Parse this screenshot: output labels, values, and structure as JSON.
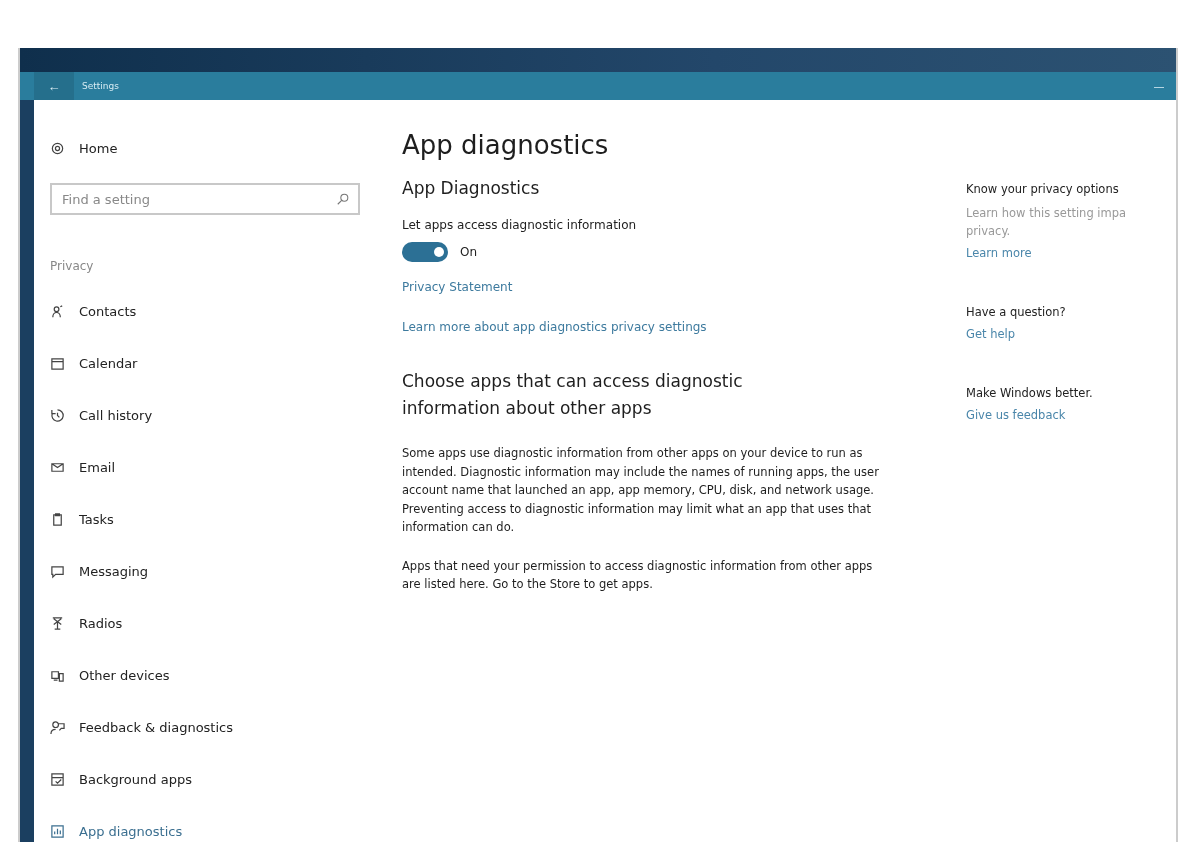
{
  "window": {
    "title": "Settings",
    "back_glyph": "←",
    "minimize_glyph": "—"
  },
  "sidebar": {
    "home": "Home",
    "search": {
      "placeholder": "Find a setting"
    },
    "section": "Privacy",
    "items": [
      {
        "label": "Contacts",
        "selected": false
      },
      {
        "label": "Calendar",
        "selected": false
      },
      {
        "label": "Call history",
        "selected": false
      },
      {
        "label": "Email",
        "selected": false
      },
      {
        "label": "Tasks",
        "selected": false
      },
      {
        "label": "Messaging",
        "selected": false
      },
      {
        "label": "Radios",
        "selected": false
      },
      {
        "label": "Other devices",
        "selected": false
      },
      {
        "label": "Feedback & diagnostics",
        "selected": false
      },
      {
        "label": "Background apps",
        "selected": false
      },
      {
        "label": "App diagnostics",
        "selected": true
      }
    ]
  },
  "content": {
    "title": "App diagnostics",
    "section_title": "App Diagnostics",
    "toggle": {
      "label": "Let apps access diagnostic information",
      "on": true,
      "state_text": "On"
    },
    "links": [
      "Privacy Statement",
      "Learn more about app diagnostics privacy settings"
    ],
    "subheading": "Choose apps that can access diagnostic information about other apps",
    "paragraphs": [
      "Some apps use diagnostic information from other apps on your device to run as intended. Diagnostic information may include the names of running apps, the user account name that launched an app, app memory, CPU, disk, and network usage. Preventing access to diagnostic information may limit what an app that uses that information can do.",
      "Apps that need your permission to access diagnostic information from other apps are listed here. Go to the Store to get apps."
    ]
  },
  "aside": [
    {
      "heading": "Know your privacy options",
      "lines": [
        "Learn how this setting impa",
        "privacy."
      ],
      "link": "Learn more"
    },
    {
      "heading": "Have a question?",
      "link": "Get help"
    },
    {
      "heading": "Make Windows better.",
      "link": "Give us feedback"
    }
  ]
}
